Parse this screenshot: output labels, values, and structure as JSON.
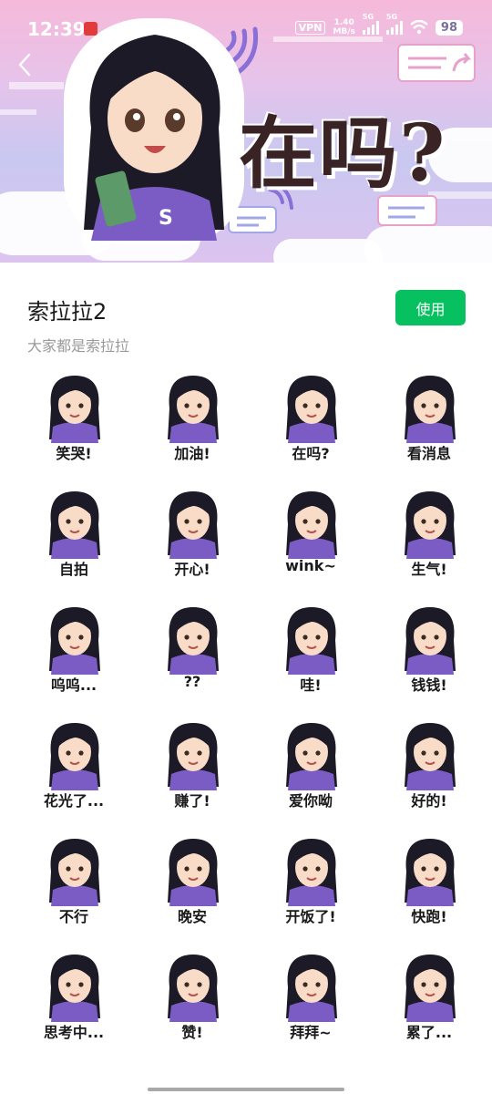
{
  "status_bar": {
    "time": "12:39",
    "vpn": "VPN",
    "speed_value": "1.40",
    "speed_unit": "MB/s",
    "signal1_label": "5G",
    "signal2_label": "5G",
    "battery": "98"
  },
  "banner": {
    "hero_text": "在吗?"
  },
  "pack": {
    "title": "索拉拉2",
    "subtitle": "大家都是索拉拉",
    "use_label": "使用"
  },
  "colors": {
    "accent_green": "#07c160",
    "hair": "#1c1a26",
    "hoodie": "#7b5bc4",
    "skin": "#f8dcc8"
  },
  "stickers": [
    {
      "label": "笑哭!"
    },
    {
      "label": "加油!"
    },
    {
      "label": "在吗?"
    },
    {
      "label": "看消息"
    },
    {
      "label": "自拍"
    },
    {
      "label": "开心!"
    },
    {
      "label": "wink~"
    },
    {
      "label": "生气!"
    },
    {
      "label": "呜呜..."
    },
    {
      "label": "??"
    },
    {
      "label": "哇!"
    },
    {
      "label": "钱钱!"
    },
    {
      "label": "花光了..."
    },
    {
      "label": "赚了!"
    },
    {
      "label": "爱你呦"
    },
    {
      "label": "好的!"
    },
    {
      "label": "不行"
    },
    {
      "label": "晚安"
    },
    {
      "label": "开饭了!"
    },
    {
      "label": "快跑!"
    },
    {
      "label": "思考中..."
    },
    {
      "label": "赞!"
    },
    {
      "label": "拜拜~"
    },
    {
      "label": "累了..."
    }
  ]
}
